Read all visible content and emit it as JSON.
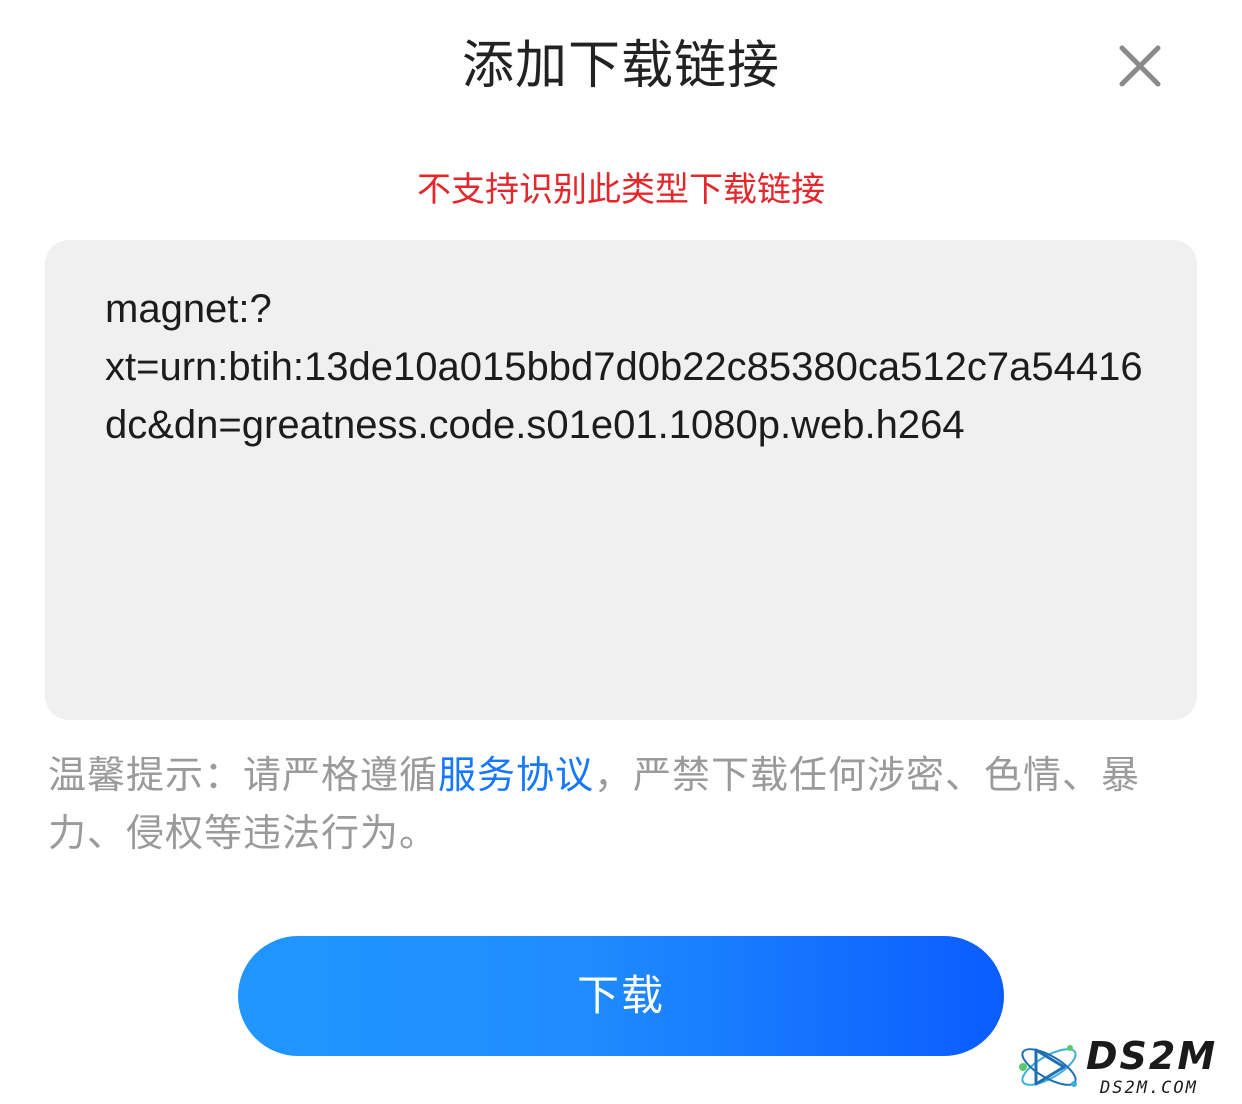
{
  "dialog": {
    "title": "添加下载链接",
    "close_icon": "close-icon",
    "error_message": "不支持识别此类型下载链接",
    "link_value": "magnet:?\nxt=urn:btih:13de10a015bbd7d0b22c85380ca512c7a54416dc&dn=greatness.code.s01e01.1080p.web.h264",
    "tip": {
      "prefix": "温馨提示：请严格遵循",
      "agreement_link": "服务协议",
      "suffix": "，严禁下载任何涉密、色情、暴力、侵权等违法行为。"
    },
    "download_button": "下载"
  },
  "watermark": {
    "title": "DS2M",
    "subtitle": "DS2M.COM"
  },
  "colors": {
    "error": "#e5262b",
    "link": "#1677ff",
    "button_gradient_start": "#2196ff",
    "button_gradient_end": "#0a5cff",
    "input_background": "#f0f0f0",
    "tip_text": "#9a9a9a"
  }
}
